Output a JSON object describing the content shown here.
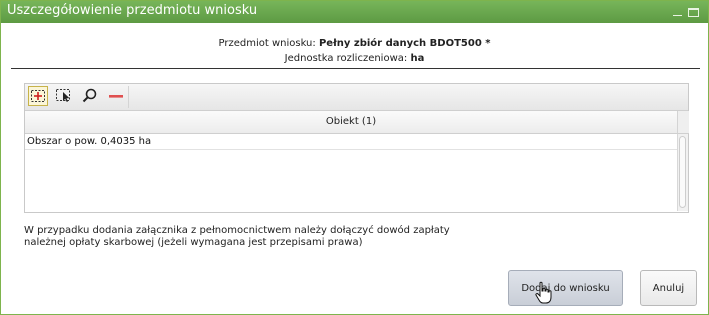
{
  "dialog": {
    "title": "Uszczegółowienie przedmiotu wniosku"
  },
  "info": {
    "subject_label": "Przedmiot wniosku:",
    "subject_value": "Pełny zbiór danych BDOT500 *",
    "unit_label": "Jednostka rozliczeniowa:",
    "unit_value": "ha"
  },
  "toolbar": {
    "icons": [
      "add-rectangle-icon",
      "select-rectangle-icon",
      "zoom-icon",
      "remove-icon"
    ]
  },
  "table": {
    "column_header": "Obiekt (1)",
    "rows": [
      "Obszar o pow. 0,4035 ha"
    ]
  },
  "note": {
    "line1": "W przypadku dodania załącznika z pełnomocnictwem należy dołączyć dowód zapłaty",
    "line2": "należnej opłaty skarbowej (jeżeli wymagana jest przepisami prawa)"
  },
  "buttons": {
    "add": "Dodaj do wniosku",
    "cancel": "Anuluj"
  },
  "colors": {
    "titlebar": "#6aa84f",
    "remove_icon": "#e05050"
  }
}
